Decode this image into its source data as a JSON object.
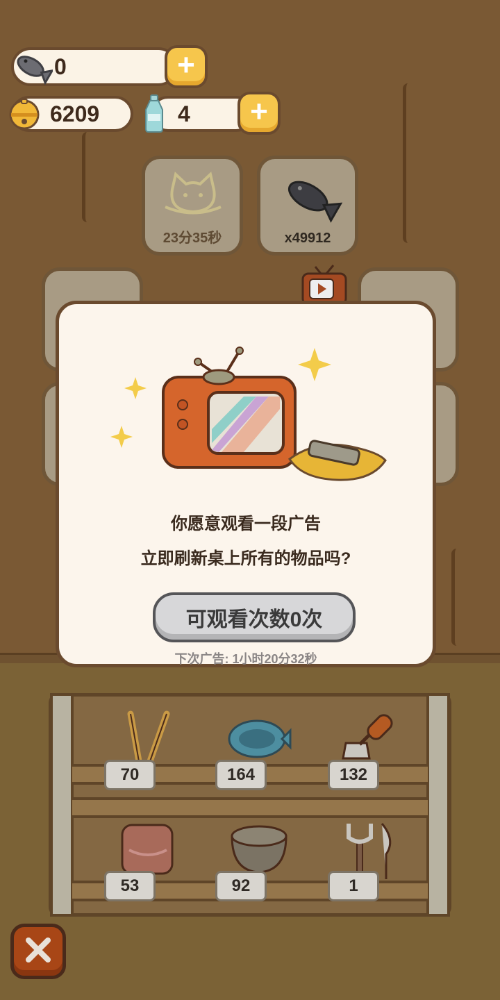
{
  "currency": {
    "fish": {
      "value": "0",
      "icon": "fish-icon"
    },
    "bells": {
      "value": "6209",
      "icon": "bell-icon"
    },
    "bottles": {
      "value": "4",
      "icon": "bottle-icon"
    }
  },
  "cards": {
    "cat_timer": {
      "label": "23分35秒",
      "icon": "cat-icon"
    },
    "fish_count": {
      "label": "x49912",
      "icon": "fish-icon"
    }
  },
  "dialog": {
    "line1": "你愿意观看一段广告",
    "line2": "立即刷新桌上所有的物品吗?",
    "button_label": "可观看次数0次",
    "next_ad": "下次广告: 1小时20分32秒"
  },
  "shelf": {
    "row1": [
      {
        "item": "chopsticks",
        "count": "70"
      },
      {
        "item": "fish-dish",
        "count": "164"
      },
      {
        "item": "spatula",
        "count": "132"
      }
    ],
    "row2": [
      {
        "item": "pot-holder",
        "count": "53"
      },
      {
        "item": "bowl",
        "count": "92"
      },
      {
        "item": "fork-knife",
        "count": "1"
      }
    ]
  },
  "colors": {
    "accent_yellow": "#f6c64c",
    "close_button": "#a84616",
    "dialog_bg": "#fcf5ec"
  }
}
